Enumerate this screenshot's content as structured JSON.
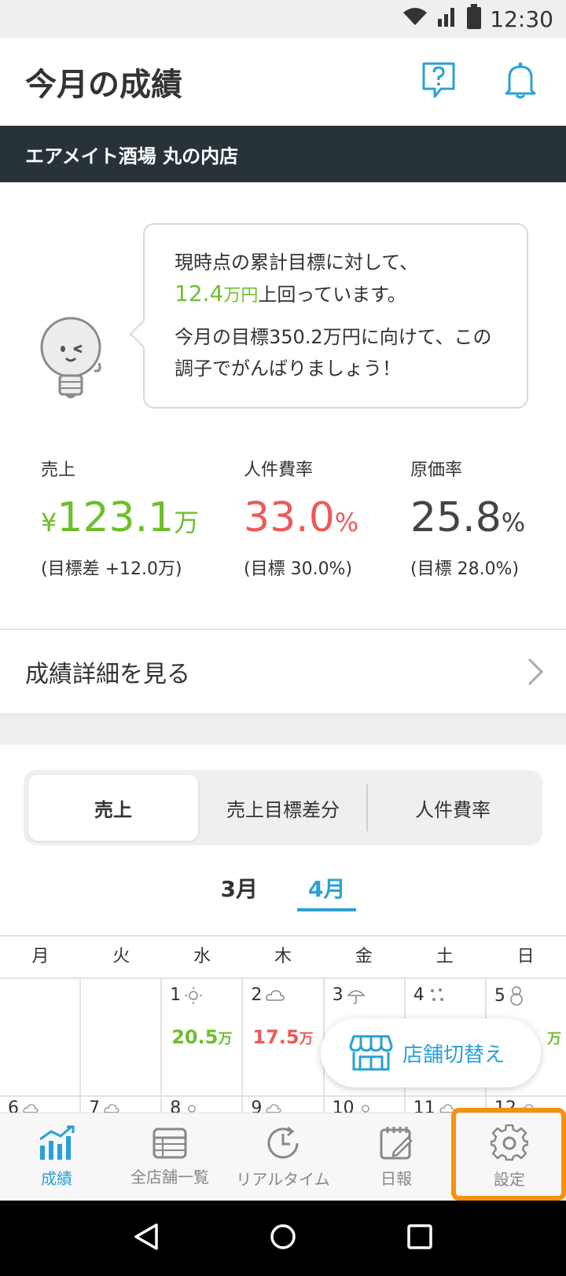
{
  "status_bar": {
    "time": "12:30"
  },
  "header": {
    "title": "今月の成績"
  },
  "store": {
    "name": "エアメイト酒場 丸の内店"
  },
  "coach": {
    "line1": "現時点の累計目標に対して、",
    "diff_value": "12.4",
    "diff_unit": "万円",
    "line2_suffix": "上回っています。",
    "line3": "今月の目標350.2万円に向けて、この",
    "line4": "調子でがんばりましょう！"
  },
  "kpis": {
    "sales": {
      "label": "売上",
      "prefix": "¥",
      "value": "123.1",
      "unit": "万",
      "target": "(目標差 +12.0万)"
    },
    "labor": {
      "label": "人件費率",
      "value": "33.0",
      "unit": "%",
      "target": "(目標 30.0%)"
    },
    "cost": {
      "label": "原価率",
      "value": "25.8",
      "unit": "%",
      "target": "(目標 28.0%)"
    }
  },
  "detail_link": {
    "label": "成績詳細を見る"
  },
  "segments": [
    "売上",
    "売上目標差分",
    "人件費率"
  ],
  "months": [
    "3月",
    "4月"
  ],
  "weekdays": [
    "月",
    "火",
    "水",
    "木",
    "金",
    "土",
    "日"
  ],
  "calendar": {
    "week1": [
      {
        "day": "",
        "weather": "",
        "amount": "",
        "unit": ""
      },
      {
        "day": "",
        "weather": "",
        "amount": "",
        "unit": ""
      },
      {
        "day": "1",
        "weather": "sun-icon",
        "amount": "20.5",
        "unit": "万"
      },
      {
        "day": "2",
        "weather": "cloud-icon",
        "amount": "17.5",
        "unit": "万"
      },
      {
        "day": "3",
        "weather": "umbrella-icon",
        "amount": "",
        "unit": ""
      },
      {
        "day": "4",
        "weather": "sleet-icon",
        "amount": "",
        "unit": ""
      },
      {
        "day": "5",
        "weather": "snowman-icon",
        "amount": "",
        "unit": "万"
      }
    ],
    "week2": [
      {
        "day": "6",
        "weather": "cloud-icon"
      },
      {
        "day": "7",
        "weather": "cloud-icon"
      },
      {
        "day": "8",
        "weather": "sun-icon"
      },
      {
        "day": "9",
        "weather": "cloud-icon"
      },
      {
        "day": "10",
        "weather": "sun-icon"
      },
      {
        "day": "11",
        "weather": "cloud-icon"
      },
      {
        "day": "12",
        "weather": "cloud-icon"
      }
    ]
  },
  "fab": {
    "label": "店舗切替え"
  },
  "tabs": [
    {
      "label": "成績",
      "icon": "chart-icon",
      "active": true
    },
    {
      "label": "全店舗一覧",
      "icon": "list-icon",
      "active": false
    },
    {
      "label": "リアルタイム",
      "icon": "clock-icon",
      "active": false
    },
    {
      "label": "日報",
      "icon": "notebook-icon",
      "active": false
    },
    {
      "label": "設定",
      "icon": "gear-icon",
      "active": false
    }
  ],
  "colors": {
    "accent": "#2aa0d6",
    "positive": "#6cbf2d",
    "negative": "#ec5a5a",
    "store_bar": "#273239",
    "highlight": "#f5920d"
  }
}
